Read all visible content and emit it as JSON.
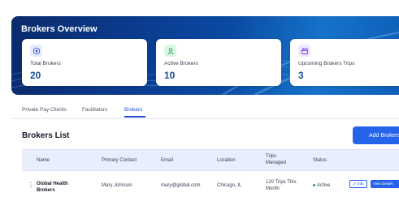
{
  "overview": {
    "title": "Brokers Overview",
    "cards": [
      {
        "label": "Total Brokers",
        "value": "20",
        "icon": "brokers-icon"
      },
      {
        "label": "Active Brokers",
        "value": "10",
        "icon": "active-user-icon"
      },
      {
        "label": "Upcoming Brokers Trips",
        "value": "3",
        "icon": "calendar-icon"
      }
    ]
  },
  "tabs": [
    {
      "label": "Private Pay Clients"
    },
    {
      "label": "Facilitators"
    },
    {
      "label": "Brokers",
      "active": true
    }
  ],
  "list": {
    "title": "Brokers List",
    "add_button": "Add Brokers"
  },
  "table": {
    "headers": {
      "name": "Name",
      "contact": "Primary Contact",
      "email": "Email",
      "location": "Location",
      "trips": "Trips Managed",
      "status": "Status"
    },
    "rows": [
      {
        "name": "Global Health Brokers",
        "contact": "Mary Johnson",
        "email": "mary@global.com",
        "location": "Chicago, IL",
        "trips": "120 Trips This Month",
        "status": "Active",
        "edit_label": "Edit",
        "view_label": "View Details"
      }
    ]
  },
  "colors": {
    "accent": "#2563eb",
    "banner": "#0b3a8c",
    "status_active": "#16a34a"
  }
}
